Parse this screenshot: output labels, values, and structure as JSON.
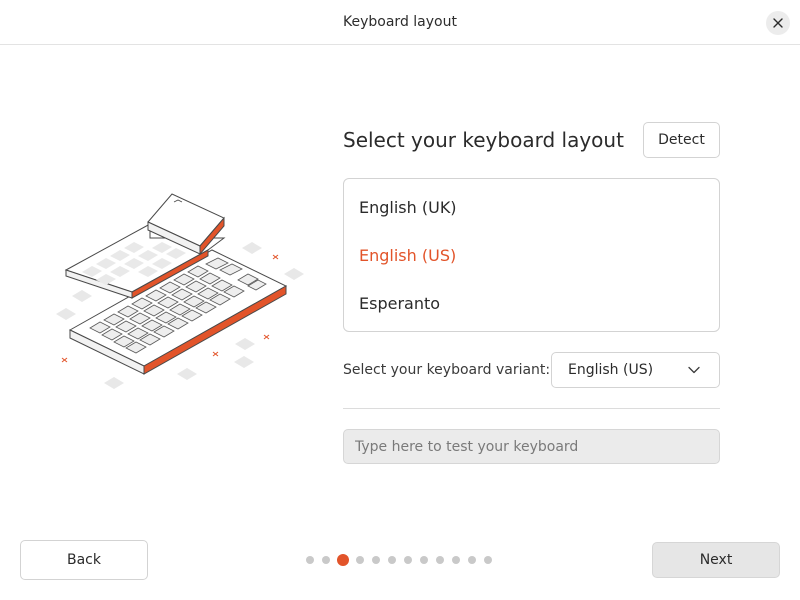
{
  "window": {
    "title": "Keyboard layout",
    "close_icon": "close-icon"
  },
  "panel": {
    "title": "Select your keyboard layout",
    "detect_label": "Detect"
  },
  "layouts": {
    "items": [
      {
        "label": "English (UK)",
        "selected": false
      },
      {
        "label": "English (US)",
        "selected": true
      },
      {
        "label": "Esperanto",
        "selected": false
      }
    ]
  },
  "variant": {
    "label": "Select your keyboard variant:",
    "value": "English (US)",
    "icon": "chevron-down-icon"
  },
  "test": {
    "placeholder": "Type here to test your keyboard",
    "value": ""
  },
  "navigation": {
    "back_label": "Back",
    "next_label": "Next"
  },
  "pager": {
    "total": 12,
    "current": 3
  },
  "colors": {
    "accent": "#e2542a",
    "selected_text": "#e2542a",
    "dot_inactive": "#c9c9c9",
    "next_button_bg": "#e6e6e6"
  }
}
